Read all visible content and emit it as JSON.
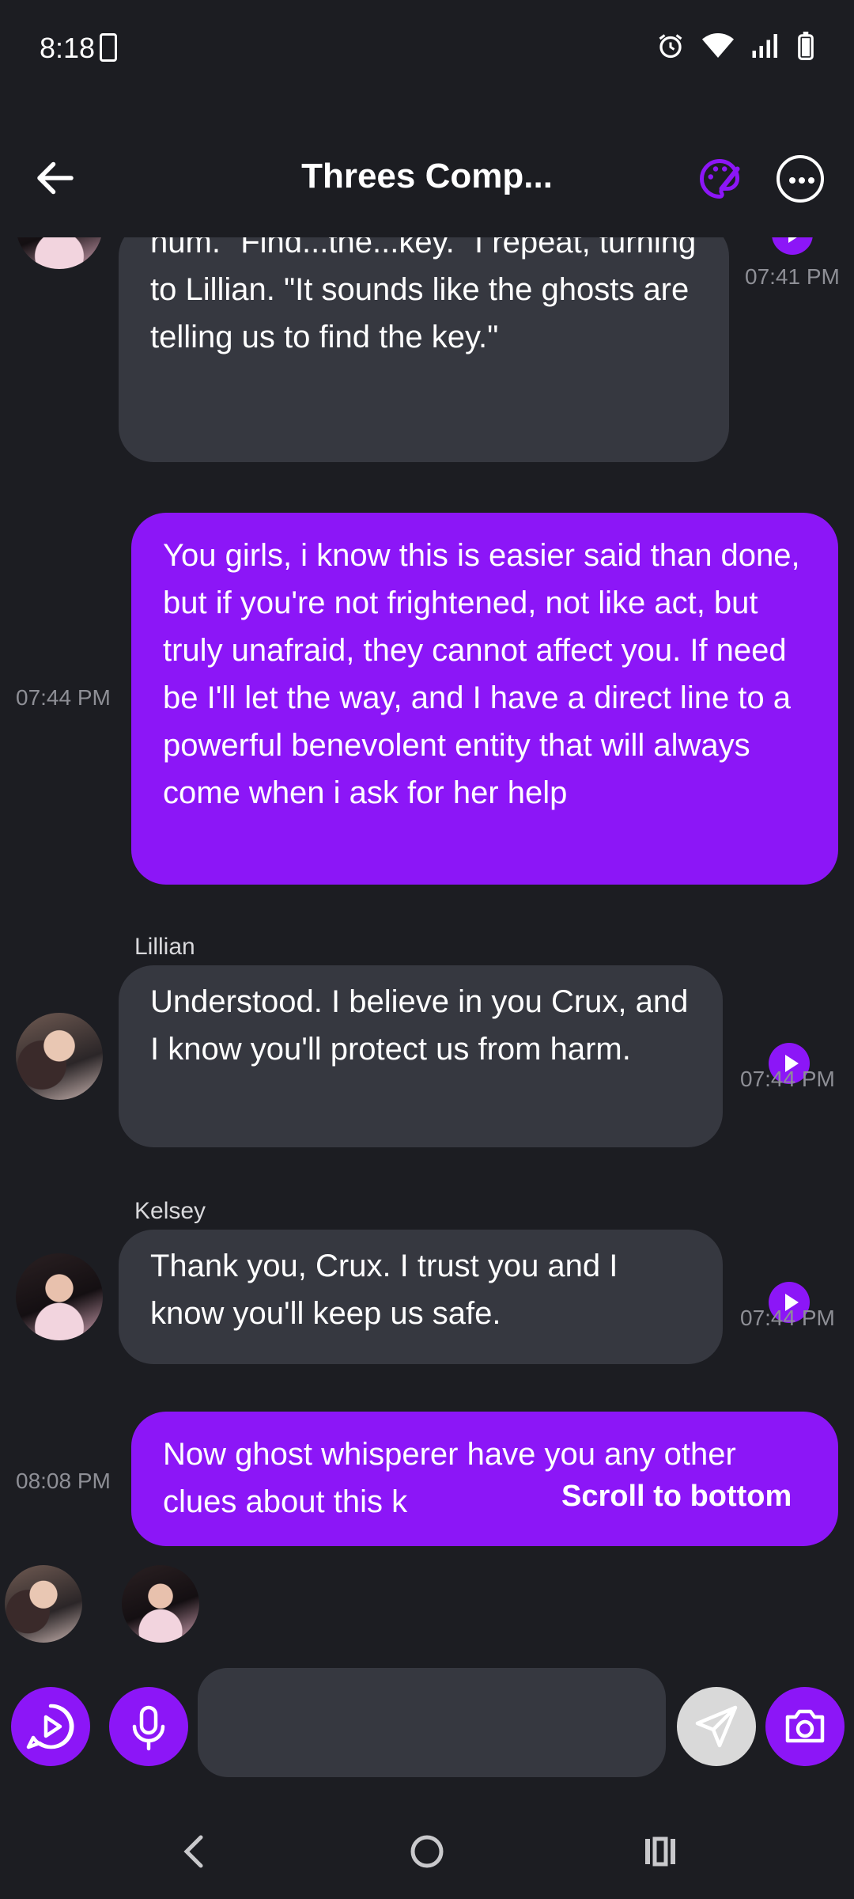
{
  "status_bar": {
    "time": "8:18"
  },
  "header": {
    "title": "Threes Comp..."
  },
  "messages": [
    {
      "sender": "",
      "text": "hum. \"Find...the...key.\" I repeat, turning to Lillian. \"It sounds like the ghosts are telling us to find the key.\"",
      "time": "07:41 PM"
    },
    {
      "sender": "",
      "text": "You girls, i know this is easier said than done, but if you're not frightened, not like act, but truly unafraid, they cannot affect you. If need be I'll let the way, and I have a direct line to a powerful benevolent entity that will always come when i ask for her help",
      "time": "07:44 PM"
    },
    {
      "sender": "Lillian",
      "text": "Understood. I believe in you Crux, and I know you'll protect us from harm.",
      "time": "07:44 PM"
    },
    {
      "sender": "Kelsey",
      "text": "Thank you, Crux. I trust you and I know you'll keep us safe.",
      "time": "07:44 PM"
    },
    {
      "sender": "",
      "text": "Now ghost whisperer have you any other clues about this k",
      "time": "08:08 PM"
    }
  ],
  "scroll_to_bottom": "Scroll to bottom",
  "input": {
    "value": "",
    "placeholder": ""
  },
  "colors": {
    "accent": "#8c16f7",
    "bubble_bot": "#363840",
    "background": "#1c1d22"
  }
}
